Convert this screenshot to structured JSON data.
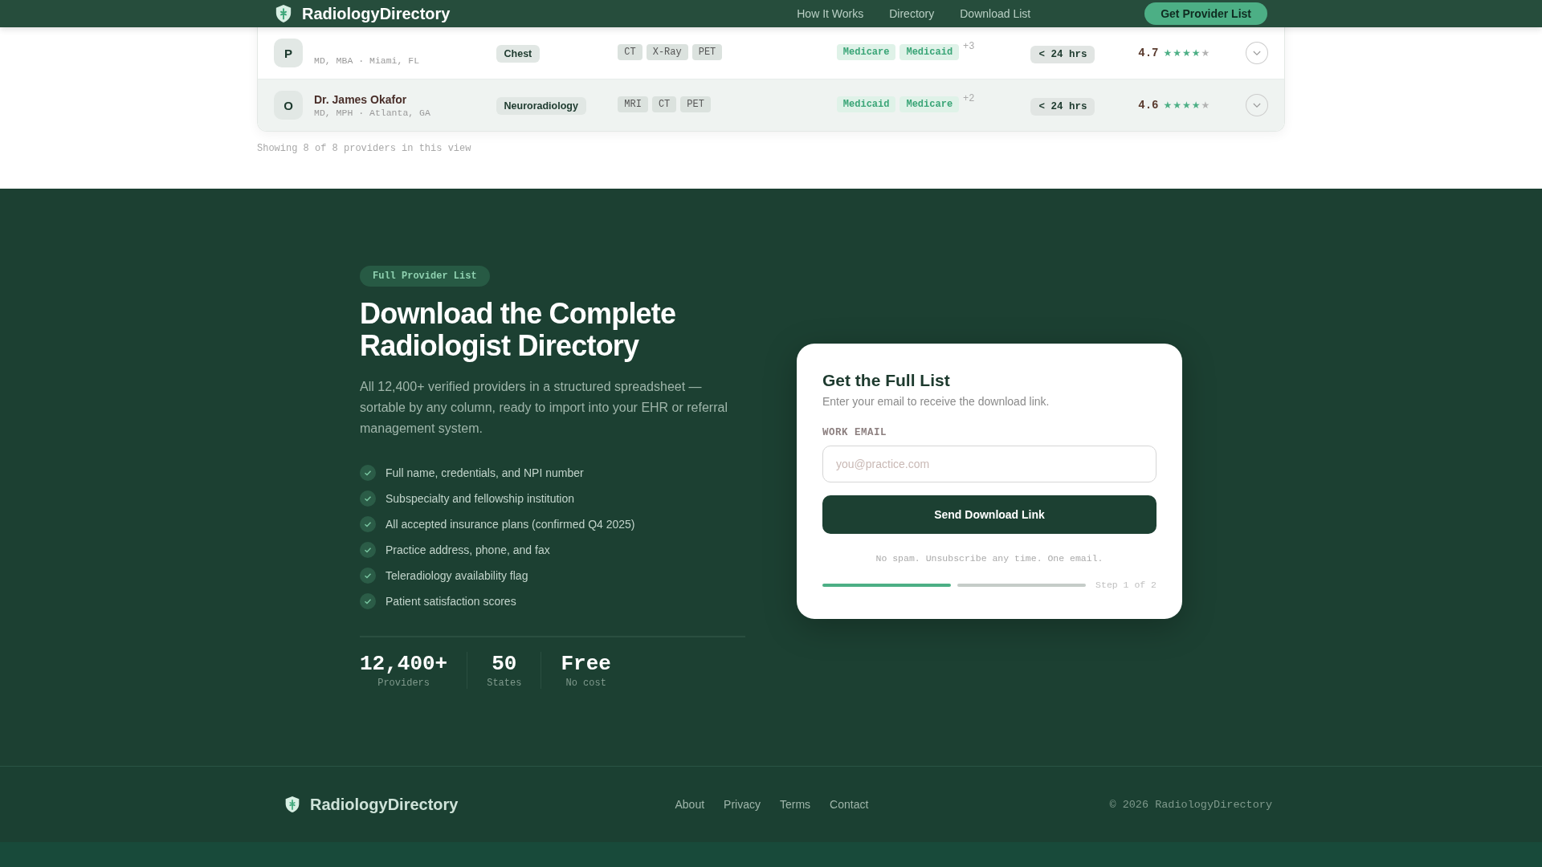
{
  "header": {
    "brand": "RadiologyDirectory",
    "nav": [
      {
        "label": "How It Works"
      },
      {
        "label": "Directory"
      },
      {
        "label": "Download List"
      }
    ],
    "cta": "Get Provider List"
  },
  "providers": [
    {
      "initial": "P",
      "credentials": "MD, MBA · Miami, FL",
      "specialty": "Chest",
      "modalities": [
        "CT",
        "X-Ray",
        "PET"
      ],
      "insurance": [
        "Medicare",
        "Medicaid"
      ],
      "more": "+3",
      "turnaround": "< 24 hrs",
      "rating": "4.7",
      "stars": 4,
      "hovered": false
    },
    {
      "initial": "O",
      "name": "Dr. James Okafor",
      "credentials": "MD, MPH · Atlanta, GA",
      "specialty": "Neuroradiology",
      "modalities": [
        "MRI",
        "CT",
        "PET"
      ],
      "insurance": [
        "Medicaid",
        "Medicare"
      ],
      "more": "+2",
      "turnaround": "< 24 hrs",
      "rating": "4.6",
      "stars": 4,
      "hovered": true
    }
  ],
  "table_footer": "Showing 8 of 8 providers in this view",
  "download": {
    "badge": "Full Provider List",
    "title": "Download the Complete Radiologist Directory",
    "description": "All 12,400+ verified providers in a structured spreadsheet — sortable by any column, ready to import into your EHR or referral management system.",
    "features": [
      "Full name, credentials, and NPI number",
      "Subspecialty and fellowship institution",
      "All accepted insurance plans (confirmed Q4 2025)",
      "Practice address, phone, and fax",
      "Teleradiology availability flag",
      "Patient satisfaction scores"
    ],
    "stats": [
      {
        "value": "12,400+",
        "label": "Providers"
      },
      {
        "value": "50",
        "label": "States"
      },
      {
        "value": "Free",
        "label": "No cost"
      }
    ]
  },
  "form": {
    "title": "Get the Full List",
    "subtitle": "Enter your email to receive the download link.",
    "field_label": "WORK EMAIL",
    "placeholder": "you@practice.com",
    "button": "Send Download Link",
    "note": "No spam. Unsubscribe any time. One email.",
    "progress": [
      {
        "done": true
      },
      {
        "done": false
      }
    ],
    "step": "Step 1 of 2"
  },
  "footer": {
    "brand": "RadiologyDirectory",
    "links": [
      "About",
      "Privacy",
      "Terms",
      "Contact"
    ],
    "copyright": "© 2026 RadiologyDirectory"
  }
}
